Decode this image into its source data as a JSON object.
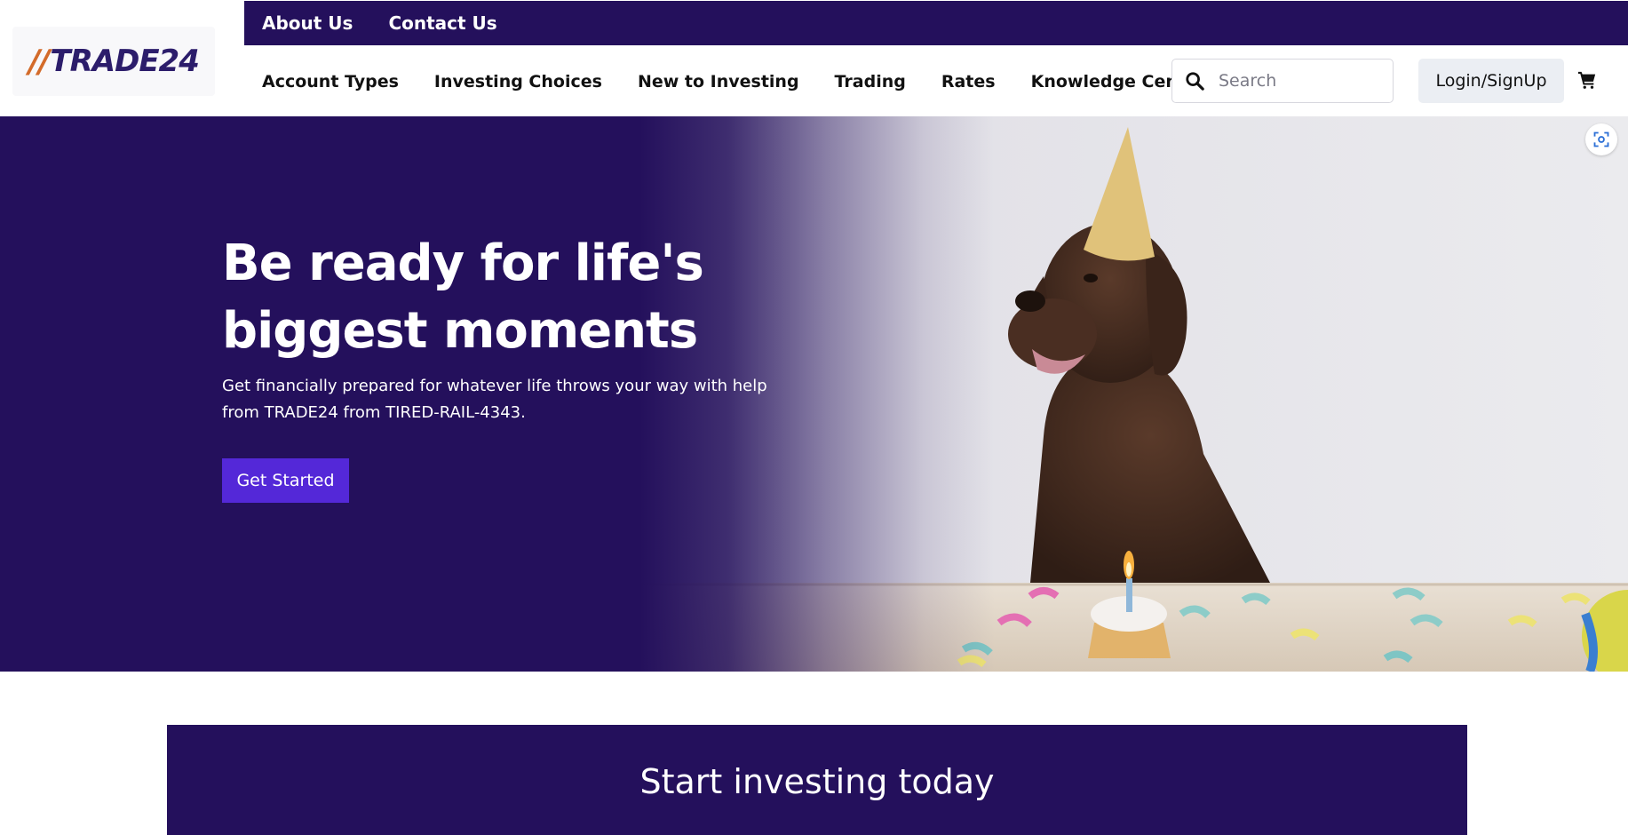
{
  "brand": {
    "slashes": "//",
    "name": "TRADE24",
    "colors": {
      "primary": "#24105c",
      "accent": "#5428d8",
      "logo_slash": "#d36b2a"
    }
  },
  "topbar": {
    "links": [
      {
        "label": "About Us"
      },
      {
        "label": "Contact Us"
      }
    ]
  },
  "nav": {
    "items": [
      {
        "label": "Account Types"
      },
      {
        "label": "Investing Choices"
      },
      {
        "label": "New to Investing"
      },
      {
        "label": "Trading"
      },
      {
        "label": "Rates"
      },
      {
        "label": "Knowledge Center"
      }
    ]
  },
  "search": {
    "placeholder": "Search",
    "value": "",
    "icon": "search-icon"
  },
  "account": {
    "login_label": "Login/SignUp",
    "cart_icon": "cart-icon"
  },
  "hero": {
    "title": "Be ready for life's biggest moments",
    "subtitle": "Get financially prepared for whatever life throws your way with help from TRADE24 from TIRED-RAIL-4343.",
    "cta_label": "Get Started",
    "scan_icon": "visual-search-icon"
  },
  "invest": {
    "title": "Start investing today"
  }
}
